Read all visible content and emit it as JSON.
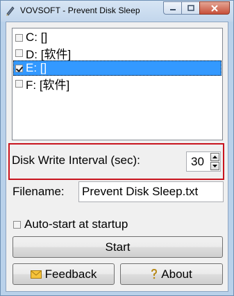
{
  "window": {
    "title": "VOVSOFT - Prevent Disk Sleep"
  },
  "drives": [
    {
      "label": "C: []",
      "checked": false,
      "selected": false
    },
    {
      "label": "D: [软件]",
      "checked": false,
      "selected": false
    },
    {
      "label": "E: []",
      "checked": true,
      "selected": true
    },
    {
      "label": "F: [软件]",
      "checked": false,
      "selected": false
    }
  ],
  "interval": {
    "label": "Disk Write Interval (sec):",
    "value": "30"
  },
  "filename": {
    "label": "Filename:",
    "value": "Prevent Disk Sleep.txt"
  },
  "autostart": {
    "label": "Auto-start at startup",
    "checked": false
  },
  "buttons": {
    "start": "Start",
    "feedback": "Feedback",
    "about": "About"
  },
  "colors": {
    "highlight": "#c8141e",
    "selection": "#3399ff"
  },
  "icons": {
    "app": "app-pen-icon",
    "feedback": "envelope-icon",
    "about": "question-icon"
  }
}
